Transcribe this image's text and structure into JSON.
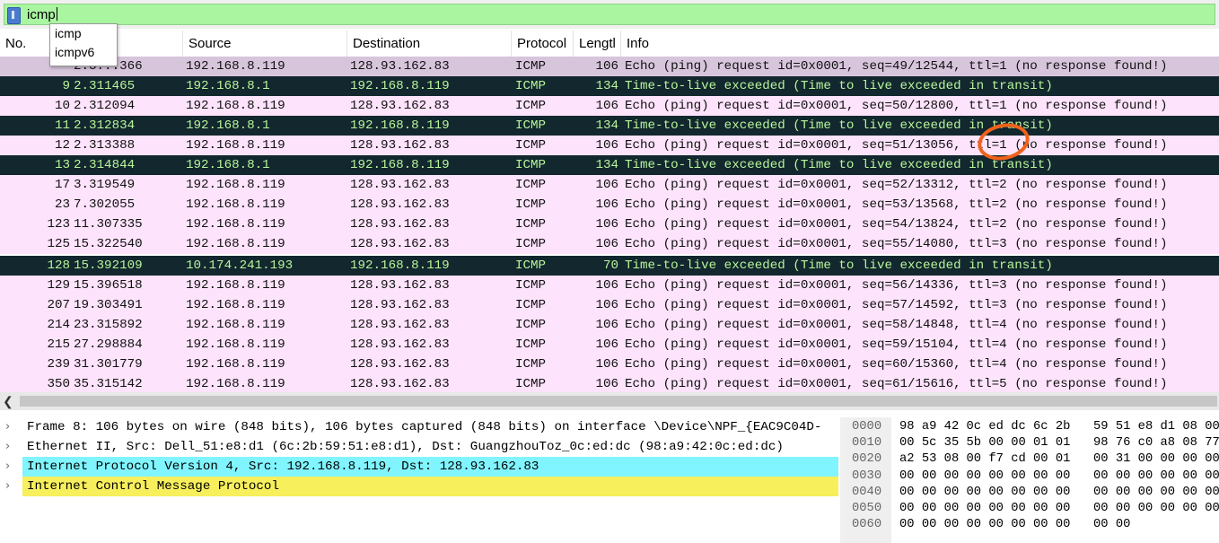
{
  "filter": {
    "value": "icmp",
    "suggestions": [
      "icmp",
      "icmpv6"
    ]
  },
  "columns": {
    "no": "No.",
    "source": "Source",
    "destination": "Destination",
    "protocol": "Protocol",
    "length": "Lengtl",
    "info": "Info"
  },
  "packets": [
    {
      "no": "",
      "time": "2.3...366",
      "src": "192.168.8.119",
      "dst": "128.93.162.83",
      "proto": "ICMP",
      "len": "106",
      "info": "Echo (ping) request  id=0x0001, seq=49/12544, ttl=1 (no response found!)",
      "kind": "sel"
    },
    {
      "no": "9",
      "time": "2.311465",
      "src": "192.168.8.1",
      "dst": "192.168.8.119",
      "proto": "ICMP",
      "len": "134",
      "info": "Time-to-live exceeded (Time to live exceeded in transit)",
      "kind": "exc"
    },
    {
      "no": "10",
      "time": "2.312094",
      "src": "192.168.8.119",
      "dst": "128.93.162.83",
      "proto": "ICMP",
      "len": "106",
      "info": "Echo (ping) request  id=0x0001, seq=50/12800, ttl=1 (no response found!)",
      "kind": "req"
    },
    {
      "no": "11",
      "time": "2.312834",
      "src": "192.168.8.1",
      "dst": "192.168.8.119",
      "proto": "ICMP",
      "len": "134",
      "info": "Time-to-live exceeded (Time to live exceeded in transit)",
      "kind": "exc"
    },
    {
      "no": "12",
      "time": "2.313388",
      "src": "192.168.8.119",
      "dst": "128.93.162.83",
      "proto": "ICMP",
      "len": "106",
      "info": "Echo (ping) request  id=0x0001, seq=51/13056, ttl=1 (no response found!)",
      "kind": "req"
    },
    {
      "no": "13",
      "time": "2.314844",
      "src": "192.168.8.1",
      "dst": "192.168.8.119",
      "proto": "ICMP",
      "len": "134",
      "info": "Time-to-live exceeded (Time to live exceeded in transit)",
      "kind": "exc"
    },
    {
      "no": "17",
      "time": "3.319549",
      "src": "192.168.8.119",
      "dst": "128.93.162.83",
      "proto": "ICMP",
      "len": "106",
      "info": "Echo (ping) request  id=0x0001, seq=52/13312, ttl=2 (no response found!)",
      "kind": "req"
    },
    {
      "no": "23",
      "time": "7.302055",
      "src": "192.168.8.119",
      "dst": "128.93.162.83",
      "proto": "ICMP",
      "len": "106",
      "info": "Echo (ping) request  id=0x0001, seq=53/13568, ttl=2 (no response found!)",
      "kind": "req"
    },
    {
      "no": "123",
      "time": "11.307335",
      "src": "192.168.8.119",
      "dst": "128.93.162.83",
      "proto": "ICMP",
      "len": "106",
      "info": "Echo (ping) request  id=0x0001, seq=54/13824, ttl=2 (no response found!)",
      "kind": "req"
    },
    {
      "no": "125",
      "time": "15.322540",
      "src": "192.168.8.119",
      "dst": "128.93.162.83",
      "proto": "ICMP",
      "len": "106",
      "info": "Echo (ping) request  id=0x0001, seq=55/14080, ttl=3 (no response found!)",
      "kind": "req"
    },
    {
      "no": "128",
      "time": "15.392109",
      "src": "10.174.241.193",
      "dst": "192.168.8.119",
      "proto": "ICMP",
      "len": "70",
      "info": "Time-to-live exceeded (Time to live exceeded in transit)",
      "kind": "exc"
    },
    {
      "no": "129",
      "time": "15.396518",
      "src": "192.168.8.119",
      "dst": "128.93.162.83",
      "proto": "ICMP",
      "len": "106",
      "info": "Echo (ping) request  id=0x0001, seq=56/14336, ttl=3 (no response found!)",
      "kind": "req"
    },
    {
      "no": "207",
      "time": "19.303491",
      "src": "192.168.8.119",
      "dst": "128.93.162.83",
      "proto": "ICMP",
      "len": "106",
      "info": "Echo (ping) request  id=0x0001, seq=57/14592, ttl=3 (no response found!)",
      "kind": "req"
    },
    {
      "no": "214",
      "time": "23.315892",
      "src": "192.168.8.119",
      "dst": "128.93.162.83",
      "proto": "ICMP",
      "len": "106",
      "info": "Echo (ping) request  id=0x0001, seq=58/14848, ttl=4 (no response found!)",
      "kind": "req"
    },
    {
      "no": "215",
      "time": "27.298884",
      "src": "192.168.8.119",
      "dst": "128.93.162.83",
      "proto": "ICMP",
      "len": "106",
      "info": "Echo (ping) request  id=0x0001, seq=59/15104, ttl=4 (no response found!)",
      "kind": "req"
    },
    {
      "no": "239",
      "time": "31.301779",
      "src": "192.168.8.119",
      "dst": "128.93.162.83",
      "proto": "ICMP",
      "len": "106",
      "info": "Echo (ping) request  id=0x0001, seq=60/15360, ttl=4 (no response found!)",
      "kind": "req"
    },
    {
      "no": "350",
      "time": "35.315142",
      "src": "192.168.8.119",
      "dst": "128.93.162.83",
      "proto": "ICMP",
      "len": "106",
      "info": "Echo (ping) request  id=0x0001, seq=61/15616, ttl=5 (no response found!)",
      "kind": "req"
    }
  ],
  "details": [
    {
      "text": "Frame 8: 106 bytes on wire (848 bits), 106 bytes captured (848 bits) on interface \\Device\\NPF_{EAC9C04D-",
      "highlight": ""
    },
    {
      "text": "Ethernet II, Src: Dell_51:e8:d1 (6c:2b:59:51:e8:d1), Dst: GuangzhouToz_0c:ed:dc (98:a9:42:0c:ed:dc)",
      "highlight": ""
    },
    {
      "text": "Internet Protocol Version 4, Src: 192.168.8.119, Dst: 128.93.162.83",
      "highlight": "ip"
    },
    {
      "text": "Internet Control Message Protocol",
      "highlight": "icmp"
    }
  ],
  "bytes": [
    {
      "offset": "0000",
      "hex1": "98 a9 42 0c ed dc 6c 2b",
      "hex2": "59 51 e8 d1 08 00"
    },
    {
      "offset": "0010",
      "hex1": "00 5c 35 5b 00 00 01 01",
      "hex2": "98 76 c0 a8 08 77"
    },
    {
      "offset": "0020",
      "hex1": "a2 53 08 00 f7 cd 00 01",
      "hex2": "00 31 00 00 00 00"
    },
    {
      "offset": "0030",
      "hex1": "00 00 00 00 00 00 00 00",
      "hex2": "00 00 00 00 00 00"
    },
    {
      "offset": "0040",
      "hex1": "00 00 00 00 00 00 00 00",
      "hex2": "00 00 00 00 00 00"
    },
    {
      "offset": "0050",
      "hex1": "00 00 00 00 00 00 00 00",
      "hex2": "00 00 00 00 00 00"
    },
    {
      "offset": "0060",
      "hex1": "00 00 00 00 00 00 00 00",
      "hex2": "00 00"
    }
  ],
  "colors": {
    "filter_valid": "#a9f5a0",
    "icmp_request_row": "#fde3fb",
    "ttl_exceeded_row": "#12272e",
    "ttl_exceeded_text": "#b9f59a",
    "selected_row": "#d7c5dc",
    "ip_highlight": "#80f5ff",
    "icmp_highlight": "#f7ef5c",
    "annotation_circle": "#f0621b"
  }
}
